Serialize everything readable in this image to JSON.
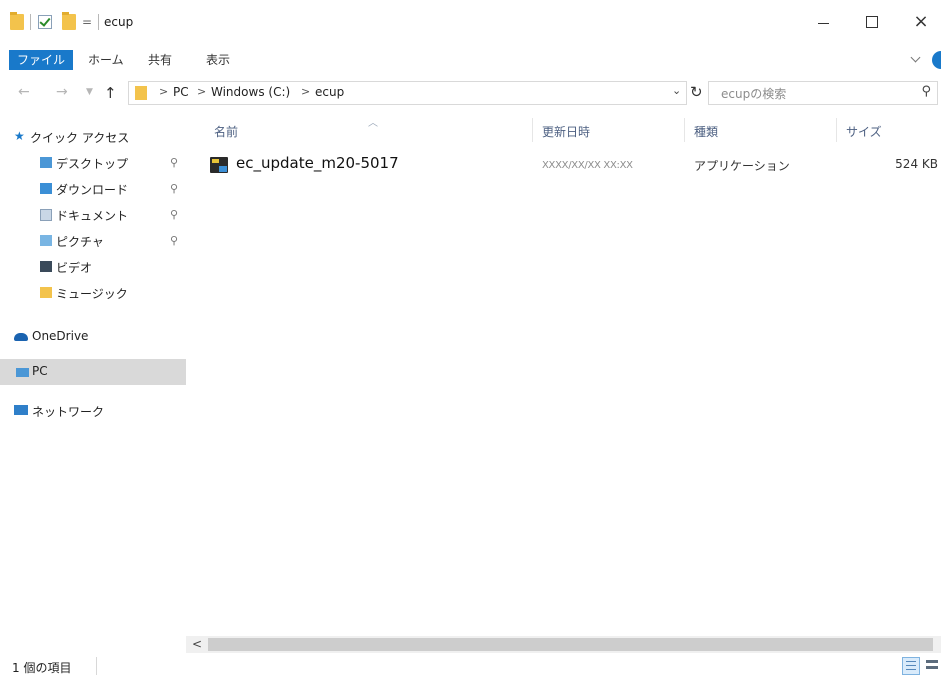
{
  "window": {
    "title": "ecup",
    "qat_arrow": "=",
    "controls": {
      "close_label": "×"
    }
  },
  "ribbon": {
    "tabs": [
      "ファイル",
      "ホーム",
      "共有",
      "表示"
    ]
  },
  "address": {
    "crumbs": [
      "PC",
      "Windows (C:)",
      "ecup"
    ],
    "separator": ">",
    "search_placeholder": "ecupの検索"
  },
  "nav": {
    "quick_access": "クイック アクセス",
    "items": [
      {
        "label": "デスクトップ",
        "pinned": true,
        "icon": "desktop-folder-icon"
      },
      {
        "label": "ダウンロード",
        "pinned": true,
        "icon": "downloads-folder-icon"
      },
      {
        "label": "ドキュメント",
        "pinned": true,
        "icon": "documents-folder-icon"
      },
      {
        "label": "ピクチャ",
        "pinned": true,
        "icon": "pictures-folder-icon"
      },
      {
        "label": "ビデオ",
        "pinned": false,
        "icon": "videos-folder-icon"
      },
      {
        "label": "ミュージック",
        "pinned": false,
        "icon": "music-folder-icon"
      }
    ],
    "onedrive": "OneDrive",
    "pc": "PC",
    "network": "ネットワーク"
  },
  "columns": {
    "name": "名前",
    "modified": "更新日時",
    "type": "種類",
    "size": "サイズ"
  },
  "files": [
    {
      "name": "ec_update_m20-5017",
      "modified": "XXXX/XX/XX XX:XX",
      "type": "アプリケーション",
      "size": "524 KB"
    }
  ],
  "status": {
    "item_count": "1 個の項目"
  },
  "colors": {
    "accent": "#1979ca",
    "selected_nav": "#d9d9d9"
  }
}
